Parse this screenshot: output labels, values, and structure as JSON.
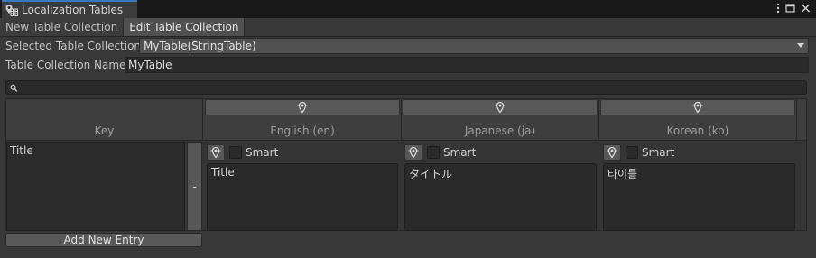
{
  "window": {
    "title": "Localization Tables",
    "controls": [
      "more-icon",
      "maximize-icon",
      "close-icon"
    ]
  },
  "subtabs": [
    {
      "label": "New Table Collection",
      "active": false
    },
    {
      "label": "Edit Table Collection",
      "active": true
    }
  ],
  "selected_collection": {
    "label": "Selected Table Collection",
    "value": "MyTable(StringTable)"
  },
  "collection_name": {
    "label": "Table Collection Name",
    "value": "MyTable"
  },
  "search": {
    "value": "",
    "icon": "search-icon"
  },
  "table": {
    "key_header": "Key",
    "languages": [
      {
        "name": "English (en)"
      },
      {
        "name": "Japanese (ja)"
      },
      {
        "name": "Korean (ko)"
      }
    ],
    "rows": [
      {
        "key": "Title",
        "remove_label": "-",
        "smart_label": "Smart",
        "values": [
          "Title",
          "タイトル",
          "타이틀"
        ]
      }
    ]
  },
  "add_entry_label": "Add New Entry",
  "colors": {
    "background": "#383838",
    "titlebar": "#191919",
    "accent": "#3a79bb"
  }
}
